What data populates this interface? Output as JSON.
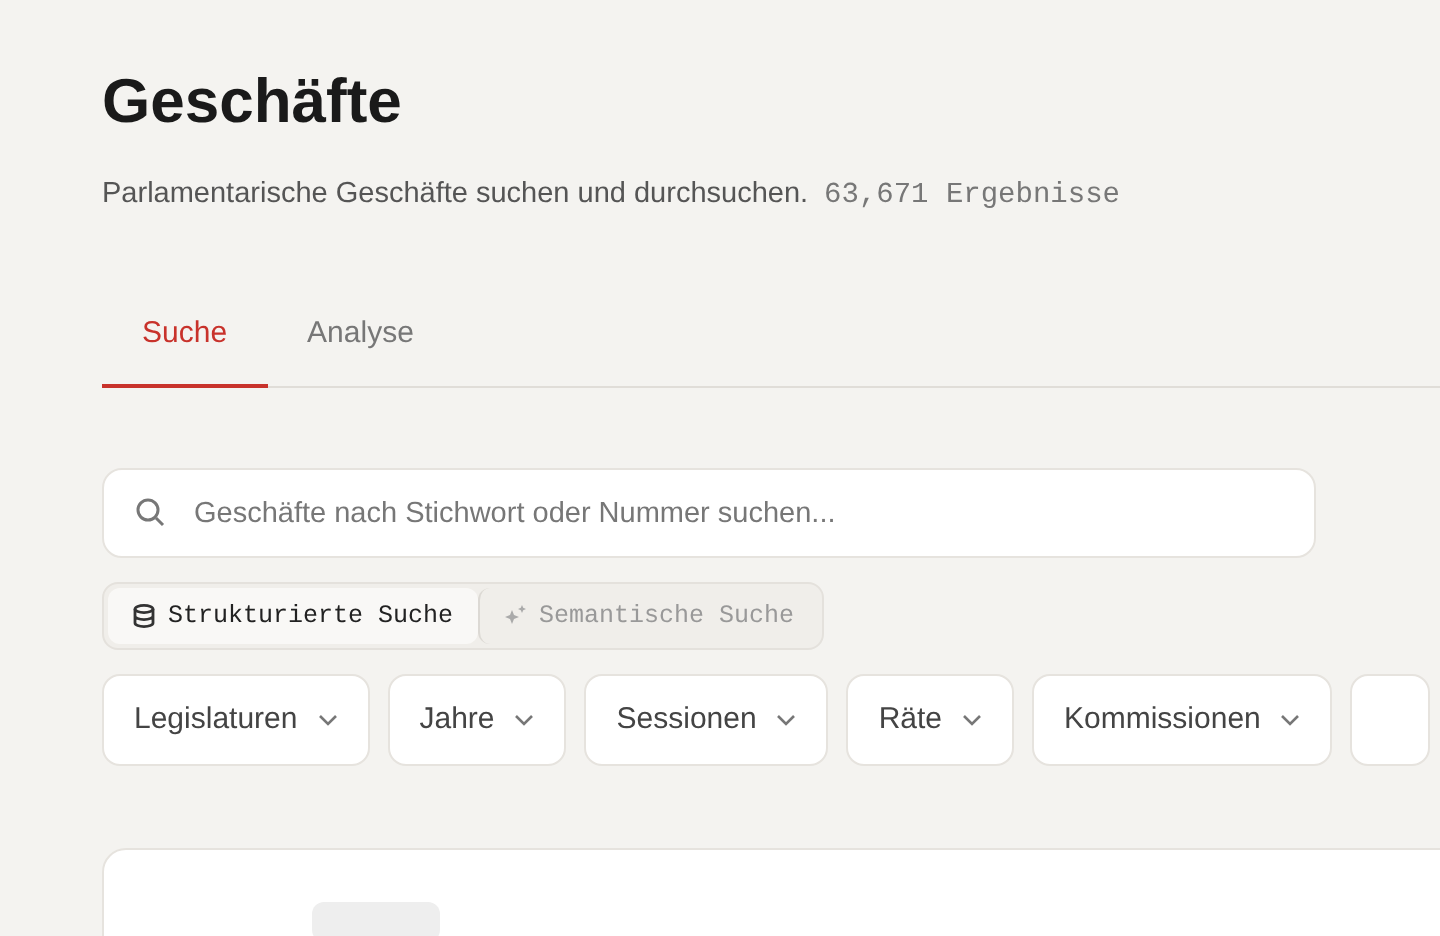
{
  "header": {
    "title": "Geschäfte",
    "subtitle": "Parlamentarische Geschäfte suchen und durchsuchen.",
    "result_count": "63,671 Ergebnisse"
  },
  "tabs": [
    {
      "label": "Suche",
      "selected": true
    },
    {
      "label": "Analyse",
      "selected": false
    }
  ],
  "search": {
    "placeholder": "Geschäfte nach Stichwort oder Nummer suchen..."
  },
  "search_modes": [
    {
      "label": "Strukturierte Suche",
      "kind": "structured",
      "selected": true
    },
    {
      "label": "Semantische Suche",
      "kind": "semantic",
      "selected": false
    }
  ],
  "filters": [
    {
      "label": "Legislaturen"
    },
    {
      "label": "Jahre"
    },
    {
      "label": "Sessionen"
    },
    {
      "label": "Räte"
    },
    {
      "label": "Kommissionen"
    }
  ]
}
